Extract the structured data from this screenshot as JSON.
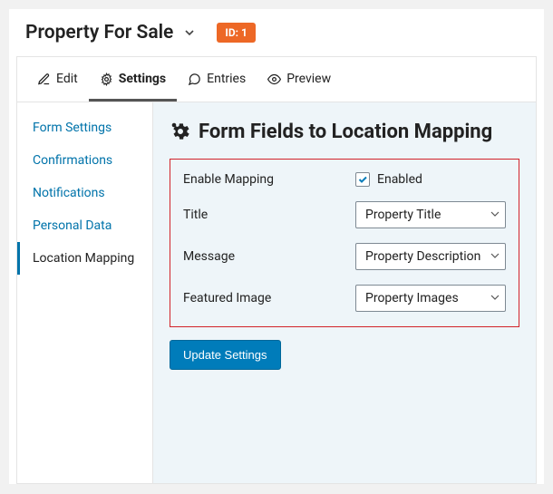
{
  "header": {
    "title": "Property For Sale",
    "id_badge": "ID: 1"
  },
  "tabs": [
    {
      "label": "Edit"
    },
    {
      "label": "Settings"
    },
    {
      "label": "Entries"
    },
    {
      "label": "Preview"
    }
  ],
  "sidebar": {
    "items": [
      {
        "label": "Form Settings"
      },
      {
        "label": "Confirmations"
      },
      {
        "label": "Notifications"
      },
      {
        "label": "Personal Data"
      },
      {
        "label": "Location Mapping"
      }
    ]
  },
  "content": {
    "title": "Form Fields to Location Mapping",
    "rows": {
      "enable_mapping": {
        "label": "Enable Mapping",
        "checkbox_label": "Enabled"
      },
      "title": {
        "label": "Title",
        "value": "Property Title"
      },
      "message": {
        "label": "Message",
        "value": "Property Description"
      },
      "featured_image": {
        "label": "Featured Image",
        "value": "Property Images"
      }
    },
    "update_button": "Update Settings"
  },
  "colors": {
    "accent": "#007cba",
    "badge": "#ed6826",
    "highlight_border": "#d2232a"
  }
}
